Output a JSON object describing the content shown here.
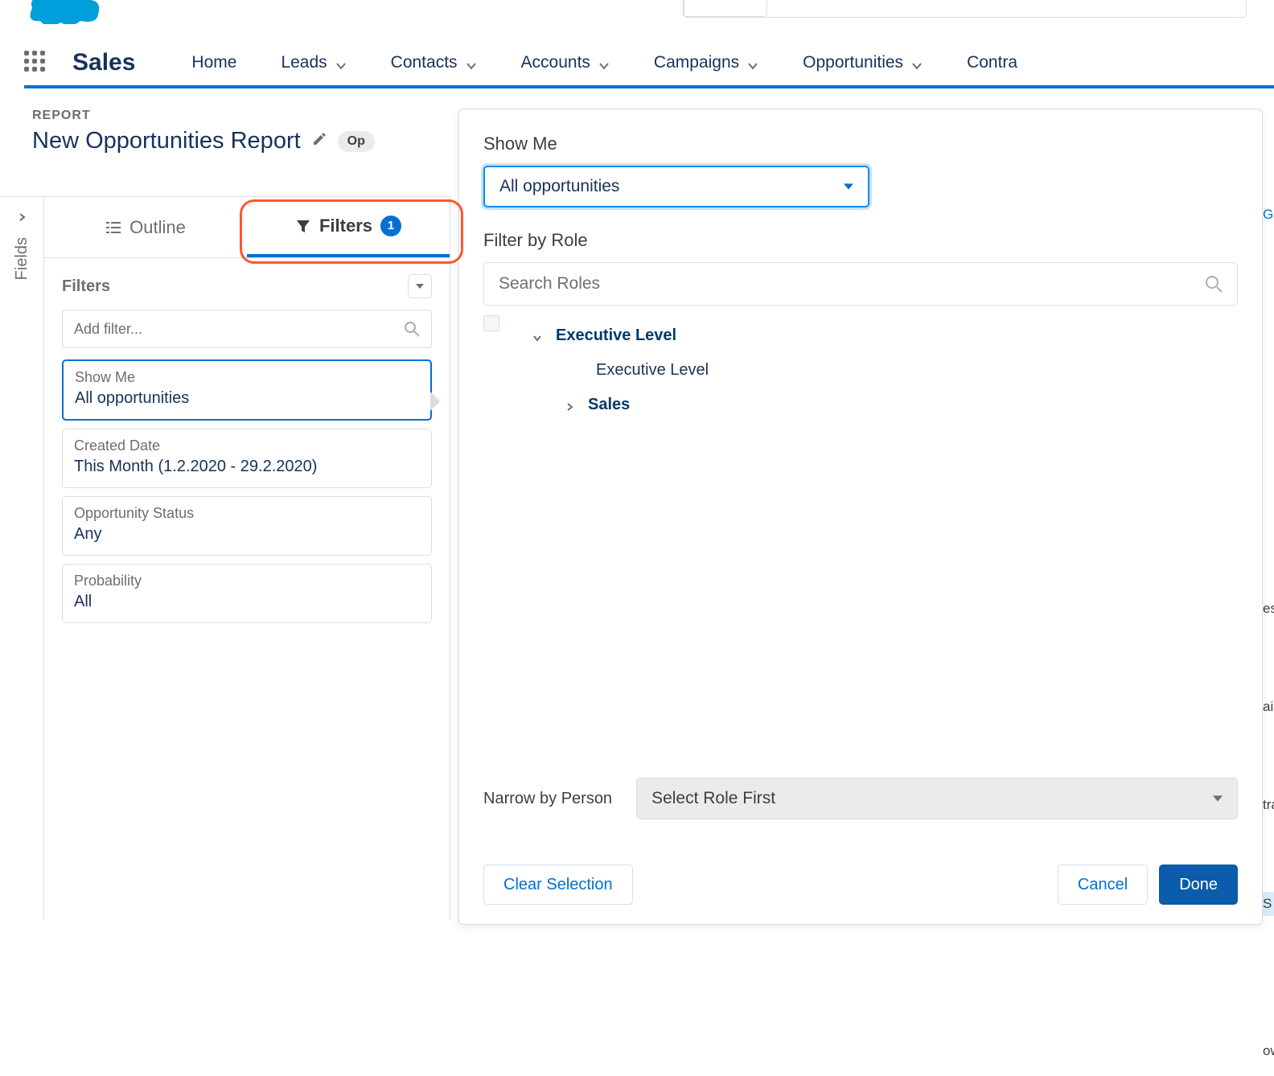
{
  "app": {
    "name": "Sales"
  },
  "nav": {
    "home": "Home",
    "leads": "Leads",
    "contacts": "Contacts",
    "accounts": "Accounts",
    "campaigns": "Campaigns",
    "opportunities": "Opportunities",
    "contracts": "Contra"
  },
  "report": {
    "label": "REPORT",
    "title": "New Opportunities Report",
    "type_pill": "Op"
  },
  "fields_rail": {
    "label": "Fields"
  },
  "tabs": {
    "outline": "Outline",
    "filters": "Filters",
    "filters_badge": "1"
  },
  "filters_panel": {
    "heading": "Filters",
    "add_placeholder": "Add filter...",
    "items": [
      {
        "label": "Show Me",
        "value": "All opportunities"
      },
      {
        "label": "Created Date",
        "value": "This Month (1.2.2020 - 29.2.2020)"
      },
      {
        "label": "Opportunity Status",
        "value": "Any"
      },
      {
        "label": "Probability",
        "value": "All"
      }
    ]
  },
  "popup": {
    "show_me_label": "Show Me",
    "show_me_value": "All opportunities",
    "filter_by_role_label": "Filter by Role",
    "search_roles_placeholder": "Search Roles",
    "tree": {
      "exec_link": "Executive Level",
      "exec_text": "Executive Level",
      "sales_link": "Sales"
    },
    "narrow_label": "Narrow by Person",
    "narrow_value": "Select Role First",
    "clear_btn": "Clear Selection",
    "cancel_btn": "Cancel",
    "done_btn": "Done"
  },
  "overflow": {
    "go": "Go",
    "es": "es",
    "ail": "ail",
    "tra": "tra",
    "s": " S",
    "ow": "ow"
  }
}
